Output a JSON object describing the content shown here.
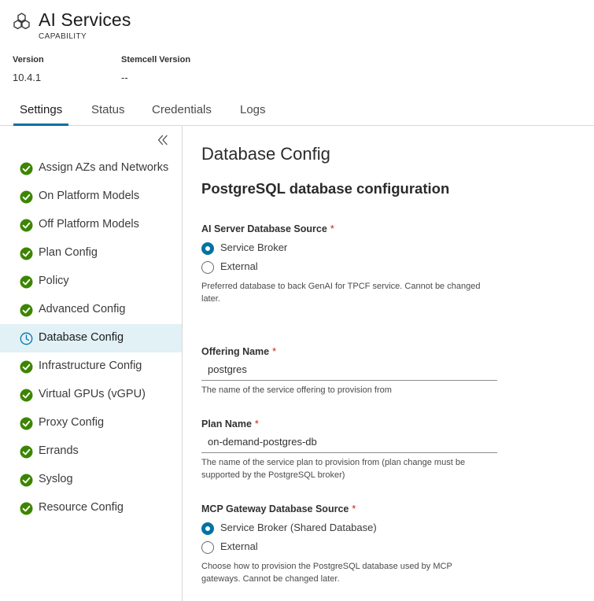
{
  "app": {
    "title": "AI Services",
    "subtitle": "CAPABILITY",
    "icon": "hexagon-cluster-icon"
  },
  "meta": {
    "version_label": "Version",
    "version_value": "10.4.1",
    "stemcell_label": "Stemcell Version",
    "stemcell_value": "--"
  },
  "tabs": [
    {
      "label": "Settings",
      "active": true
    },
    {
      "label": "Status",
      "active": false
    },
    {
      "label": "Credentials",
      "active": false
    },
    {
      "label": "Logs",
      "active": false
    }
  ],
  "sidebar": {
    "collapse_icon": "double-chevron-left-icon",
    "items": [
      {
        "label": "Assign AZs and Networks",
        "status": "complete"
      },
      {
        "label": "On Platform Models",
        "status": "complete"
      },
      {
        "label": "Off Platform Models",
        "status": "complete"
      },
      {
        "label": "Plan Config",
        "status": "complete"
      },
      {
        "label": "Policy",
        "status": "complete"
      },
      {
        "label": "Advanced Config",
        "status": "complete"
      },
      {
        "label": "Database Config",
        "status": "in-progress"
      },
      {
        "label": "Infrastructure Config",
        "status": "complete"
      },
      {
        "label": "Virtual GPUs (vGPU)",
        "status": "complete"
      },
      {
        "label": "Proxy Config",
        "status": "complete"
      },
      {
        "label": "Errands",
        "status": "complete"
      },
      {
        "label": "Syslog",
        "status": "complete"
      },
      {
        "label": "Resource Config",
        "status": "complete"
      }
    ]
  },
  "content": {
    "page_title": "Database Config",
    "section_title": "PostgreSQL database configuration",
    "ai_db_source": {
      "label": "AI Server Database Source",
      "required_mark": "*",
      "options": [
        "Service Broker",
        "External"
      ],
      "selected": "Service Broker",
      "helper": "Preferred database to back GenAI for TPCF service. Cannot be changed later."
    },
    "offering_name": {
      "label": "Offering Name",
      "required_mark": "*",
      "value": "postgres",
      "helper": "The name of the service offering to provision from"
    },
    "plan_name": {
      "label": "Plan Name",
      "required_mark": "*",
      "value": "on-demand-postgres-db",
      "helper": "The name of the service plan to provision from (plan change must be supported by the PostgreSQL broker)"
    },
    "mcp_db_source": {
      "label": "MCP Gateway Database Source",
      "required_mark": "*",
      "options": [
        "Service Broker (Shared Database)",
        "External"
      ],
      "selected": "Service Broker (Shared Database)",
      "helper": "Choose how to provision the PostgreSQL database used by MCP gateways. Cannot be changed later."
    }
  },
  "colors": {
    "accent": "#0072a3",
    "success": "#3c8500",
    "active_bg": "#e1f1f6",
    "required": "#c92100"
  }
}
